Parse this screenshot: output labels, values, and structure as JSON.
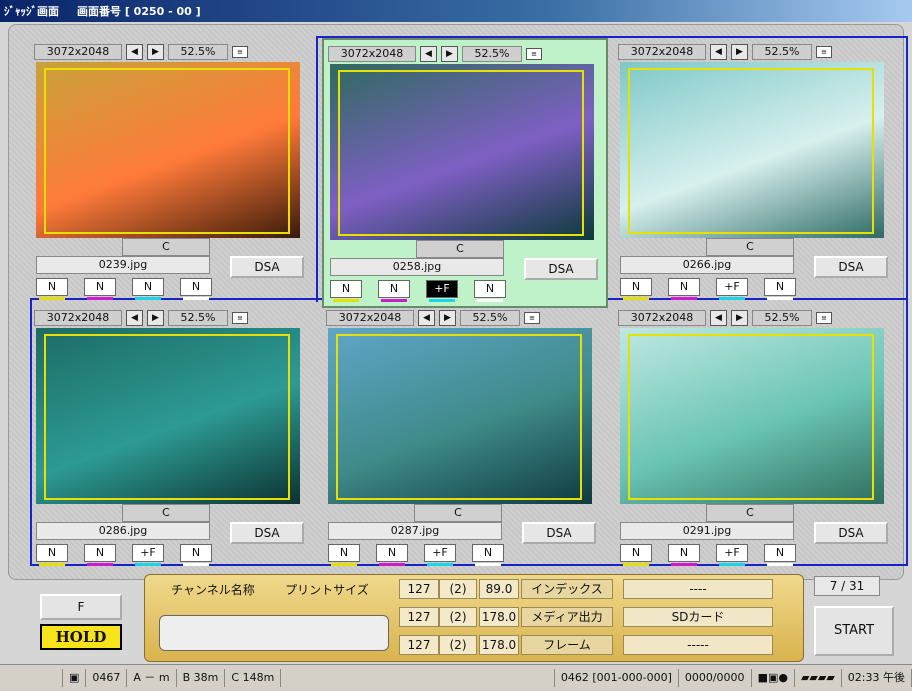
{
  "title": {
    "app": "ｼﾞｬｯｼﾞ画面",
    "screen_no": "画面番号 [ 0250 - 00 ]"
  },
  "panels": [
    {
      "res": "3072x2048",
      "zoom": "52.5%",
      "c": "C",
      "file": "0239.jpg",
      "dsa": "DSA",
      "btns": [
        "N",
        "N",
        "N",
        "N"
      ],
      "selected": false,
      "colors": [
        "#c9a23a",
        "#ff7a3a",
        "#3a1a08"
      ]
    },
    {
      "res": "3072x2048",
      "zoom": "52.5%",
      "c": "C",
      "file": "0258.jpg",
      "dsa": "DSA",
      "btns": [
        "N",
        "N",
        "+F",
        "N"
      ],
      "selected": true,
      "colors": [
        "#2e6b5e",
        "#7e5fc4",
        "#0c3a3a"
      ]
    },
    {
      "res": "3072x2048",
      "zoom": "52.5%",
      "c": "C",
      "file": "0266.jpg",
      "dsa": "DSA",
      "btns": [
        "N",
        "N",
        "+F",
        "N"
      ],
      "selected": false,
      "colors": [
        "#7ec8c8",
        "#d7f0ee",
        "#2e6a66"
      ]
    },
    {
      "res": "3072x2048",
      "zoom": "52.5%",
      "c": "C",
      "file": "0286.jpg",
      "dsa": "DSA",
      "btns": [
        "N",
        "N",
        "+F",
        "N"
      ],
      "selected": false,
      "colors": [
        "#1d6b66",
        "#2d9a94",
        "#0c3331"
      ]
    },
    {
      "res": "3072x2048",
      "zoom": "52.5%",
      "c": "C",
      "file": "0287.jpg",
      "dsa": "DSA",
      "btns": [
        "N",
        "N",
        "+F",
        "N"
      ],
      "selected": false,
      "colors": [
        "#5fa6c8",
        "#3f8a8a",
        "#0f3a40"
      ]
    },
    {
      "res": "3072x2048",
      "zoom": "52.5%",
      "c": "C",
      "file": "0291.jpg",
      "dsa": "DSA",
      "btns": [
        "N",
        "N",
        "+F",
        "N"
      ],
      "selected": false,
      "colors": [
        "#bfe8e2",
        "#6ac4b4",
        "#2f6d5c"
      ]
    }
  ],
  "underline_colors": [
    "#e6e000",
    "#d01ad0",
    "#19d6e6",
    "#ffffff"
  ],
  "left": {
    "f": "F",
    "hold": "HOLD"
  },
  "table": {
    "channel": "チャンネル名称",
    "print_size": "プリントサイズ",
    "rows": [
      {
        "a": "127",
        "b": "(2)",
        "c": "89.0",
        "label": "インデックス",
        "value": "----"
      },
      {
        "a": "127",
        "b": "(2)",
        "c": "178.0",
        "label": "メディア出力",
        "value": "SDカード"
      },
      {
        "a": "127",
        "b": "(2)",
        "c": "178.0",
        "label": "フレーム",
        "value": "-----"
      }
    ]
  },
  "page": "7 / 31",
  "start": "START",
  "status": {
    "count": "0467",
    "a": "A － m",
    "b": "B  38m",
    "c": "C 148m",
    "code": "0462 [001-000-000]",
    "frac": "0000/0000",
    "time": "02:33 午後"
  }
}
